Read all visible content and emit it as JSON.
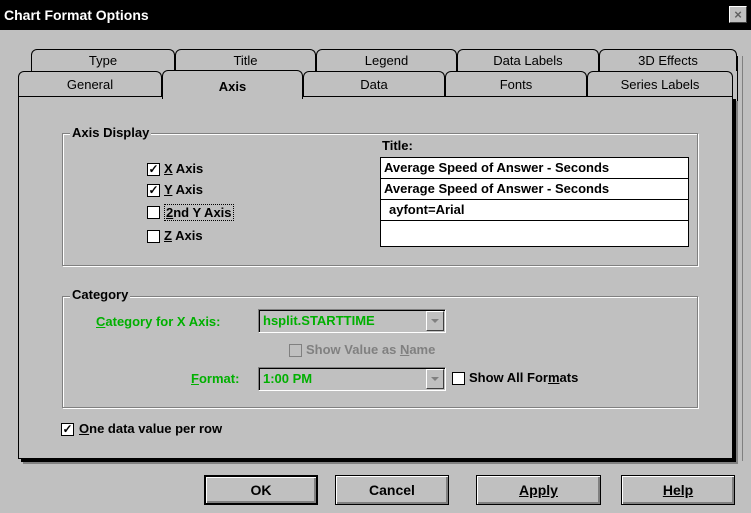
{
  "window": {
    "title": "Chart Format Options",
    "close_glyph": "×"
  },
  "tabs_row1": [
    "Type",
    "Title",
    "Legend",
    "Data Labels",
    "3D Effects"
  ],
  "tabs_row2": [
    "General",
    "Axis",
    "Data",
    "Fonts",
    "Series Labels"
  ],
  "active_tab": "Axis",
  "axis_display": {
    "group_title": "Axis Display",
    "title_label": "Title:",
    "checkboxes": [
      {
        "label": "X Axis",
        "checked": true
      },
      {
        "label": "Y Axis",
        "checked": true
      },
      {
        "label": "2nd Y Axis",
        "checked": false
      },
      {
        "label": "Z Axis",
        "checked": false
      }
    ],
    "title_lines": [
      "Average Speed of Answer - Seconds",
      "Average Speed of Answer - Seconds",
      "ayfont=Arial",
      ""
    ]
  },
  "category": {
    "group_title": "Category",
    "category_label": "Category for X Axis:",
    "category_value": "hsplit.STARTTIME",
    "show_value_label": "Show Value as Name",
    "format_label": "Format:",
    "format_value": "1:00 PM",
    "show_all_formats_label": "Show All Formats"
  },
  "one_value_per_row": {
    "label": "One data value per row",
    "checked": true
  },
  "buttons": {
    "ok": "OK",
    "cancel": "Cancel",
    "apply": "Apply",
    "help": "Help"
  },
  "colors": {
    "accent_green": "#00b000",
    "dialog_face": "#c0c0c0",
    "titlebar": "#000000"
  },
  "icons": {
    "check": "✓"
  }
}
